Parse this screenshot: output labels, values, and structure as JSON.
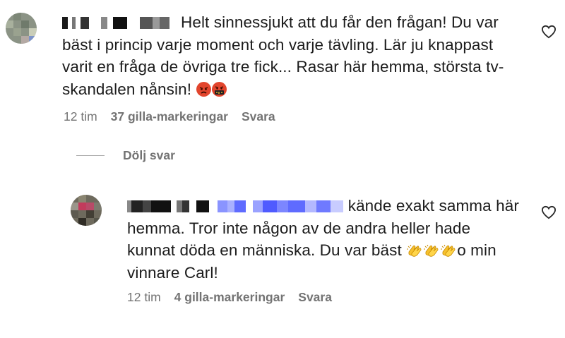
{
  "comments": [
    {
      "text": "Helt sinnessjukt att du får den frågan! Du var bäst i princip varje moment och varje tävling. Lär ju knappast varit en fråga de övriga tre fick... Rasar här hemma, största tv-skandalen nånsin!",
      "emojis": [
        "angry-face",
        "cursing-face"
      ],
      "time": "12 tim",
      "likes": "37 gilla-markeringar",
      "reply_label": "Svara"
    },
    {
      "text_part1": "kände exakt samma här hemma. Tror inte någon av de andra heller hade kunnat döda en människa. Du var bäst",
      "emojis": [
        "clapping-hands",
        "clapping-hands",
        "clapping-hands"
      ],
      "text_part2": "o min vinnare Carl!",
      "time": "12 tim",
      "likes": "4 gilla-markeringar",
      "reply_label": "Svara"
    }
  ],
  "hide_replies_label": "Dölj svar",
  "colors": {
    "meta_gray": "#737373",
    "mention_blue": "#5f6bff",
    "text": "#1c1c1c"
  }
}
